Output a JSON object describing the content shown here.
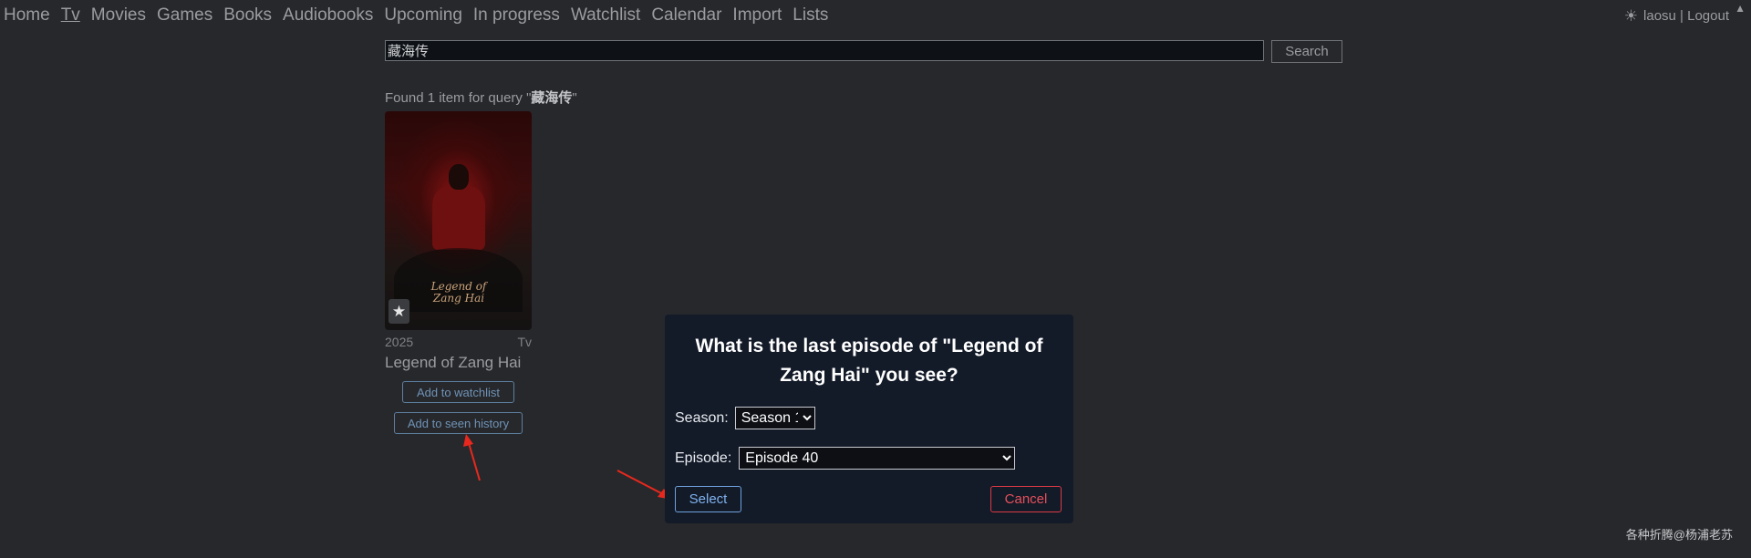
{
  "nav": {
    "items": [
      "Home",
      "Tv",
      "Movies",
      "Games",
      "Books",
      "Audiobooks",
      "Upcoming",
      "In progress",
      "Watchlist",
      "Calendar",
      "Import",
      "Lists"
    ],
    "active": "Tv"
  },
  "user": {
    "theme_icon": "sun-icon",
    "label": "laosu | Logout"
  },
  "search": {
    "value": "藏海传",
    "button": "Search"
  },
  "results": {
    "prefix": "Found 1 item for query \"",
    "query": "藏海传",
    "suffix": "\""
  },
  "card": {
    "year": "2025",
    "type": "Tv",
    "title": "Legend of Zang Hai",
    "poster_text_1": "Legend of",
    "poster_text_2": "Zang Hai",
    "watchlist_button": "Add to watchlist",
    "history_button": "Add to seen history"
  },
  "modal": {
    "heading": "What is the last episode of \"Legend of Zang Hai\" you see?",
    "season_label": "Season:",
    "season_value": "Season 1",
    "episode_label": "Episode:",
    "episode_value": "Episode 40",
    "select_button": "Select",
    "cancel_button": "Cancel"
  },
  "watermark": "各种折腾@杨浦老苏",
  "colors": {
    "accent_blue": "#6fa2de",
    "cancel_red": "#dc3a45",
    "arrow_red": "#e8281e"
  }
}
